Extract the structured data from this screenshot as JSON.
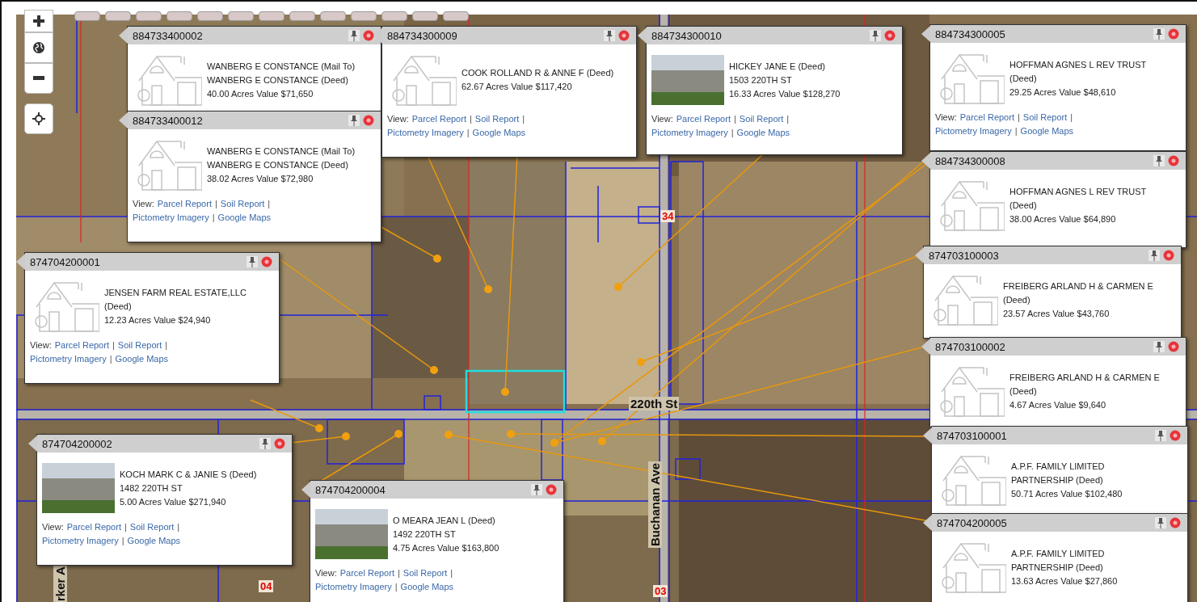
{
  "map": {
    "controls": [
      {
        "kind": "zoom_in"
      },
      {
        "kind": "globe"
      },
      {
        "kind": "zoom_out"
      },
      {
        "kind": "locate"
      }
    ],
    "labels": [
      {
        "text": "34",
        "kind": "section"
      },
      {
        "text": "220th St",
        "kind": "road"
      },
      {
        "text": "Buchanan Ave",
        "kind": "road_vertical"
      },
      {
        "text": "rker A",
        "kind": "road_vertical"
      },
      {
        "text": "04",
        "kind": "section"
      },
      {
        "text": "03",
        "kind": "section"
      }
    ]
  },
  "popups": [
    {
      "parcel": "884733400002",
      "kind": "sketch",
      "lines": [
        "WANBERG E CONSTANCE (Mail To)",
        "WANBERG E CONSTANCE (Deed)",
        "40.00 Acres  Value $71,650"
      ]
    },
    {
      "parcel": "884733400012",
      "kind": "sketch",
      "lines": [
        "WANBERG E CONSTANCE (Mail To)",
        "WANBERG E CONSTANCE (Deed)",
        "38.02 Acres  Value $72,980"
      ],
      "view_label": "View:",
      "separator": "|",
      "links": [
        "Parcel Report",
        "Soil Report",
        "Pictometry Imagery",
        "Google Maps"
      ]
    },
    {
      "parcel": "874704200001",
      "kind": "sketch",
      "lines": [
        "JENSEN FARM REAL ESTATE,LLC",
        "(Deed)",
        "12.23 Acres  Value $24,940"
      ],
      "view_label": "View:",
      "separator": "|",
      "links": [
        "Parcel Report",
        "Soil Report",
        "Pictometry Imagery",
        "Google Maps"
      ]
    },
    {
      "parcel": "884734300009",
      "kind": "sketch",
      "lines": [
        "COOK ROLLAND R & ANNE F (Deed)",
        "62.67 Acres  Value $117,420"
      ],
      "view_label": "View:",
      "separator": "|",
      "links": [
        "Parcel Report",
        "Soil Report",
        "Pictometry Imagery",
        "Google Maps"
      ]
    },
    {
      "parcel": "884734300010",
      "kind": "photo",
      "lines": [
        "HICKEY JANE E (Deed)",
        "1503 220TH ST",
        "16.33 Acres  Value $128,270"
      ],
      "view_label": "View:",
      "separator": "|",
      "links": [
        "Parcel Report",
        "Soil Report",
        "Pictometry Imagery",
        "Google Maps"
      ]
    },
    {
      "parcel": "884734300005",
      "kind": "sketch",
      "lines": [
        "HOFFMAN AGNES L REV TRUST",
        "(Deed)",
        "29.25 Acres  Value $48,610"
      ],
      "view_label": "View:",
      "separator": "|",
      "links": [
        "Parcel Report",
        "Soil Report",
        "Pictometry Imagery",
        "Google Maps"
      ]
    },
    {
      "parcel": "884734300008",
      "kind": "sketch",
      "lines": [
        "HOFFMAN AGNES L REV TRUST",
        "(Deed)",
        "38.00 Acres  Value $64,890"
      ]
    },
    {
      "parcel": "874703100003",
      "kind": "sketch",
      "lines": [
        "FREIBERG ARLAND H & CARMEN E",
        "(Deed)",
        "23.57 Acres  Value $43,760"
      ]
    },
    {
      "parcel": "874703100002",
      "kind": "sketch",
      "lines": [
        "FREIBERG ARLAND H & CARMEN E",
        "(Deed)",
        "4.67 Acres  Value $9,640"
      ]
    },
    {
      "parcel": "874703100001",
      "kind": "sketch",
      "lines": [
        "A.P.F. FAMILY LIMITED",
        "PARTNERSHIP (Deed)",
        "50.71 Acres  Value $102,480"
      ]
    },
    {
      "parcel": "874704200005",
      "kind": "sketch",
      "lines": [
        "A.P.F. FAMILY LIMITED",
        "PARTNERSHIP (Deed)",
        "13.63 Acres  Value $27,860"
      ]
    },
    {
      "parcel": "874704200002",
      "kind": "photo",
      "lines": [
        "KOCH MARK C & JANIE S (Deed)",
        "1482 220TH ST",
        "5.00 Acres  Value $271,940"
      ],
      "view_label": "View:",
      "separator": "|",
      "links": [
        "Parcel Report",
        "Soil Report",
        "Pictometry Imagery",
        "Google Maps"
      ]
    },
    {
      "parcel": "874704200004",
      "kind": "photo",
      "lines": [
        "O MEARA JEAN L (Deed)",
        "1492 220TH ST",
        "4.75 Acres  Value $163,800"
      ],
      "view_label": "View:",
      "separator": "|",
      "links": [
        "Parcel Report",
        "Soil Report",
        "Pictometry Imagery",
        "Google Maps"
      ]
    }
  ]
}
